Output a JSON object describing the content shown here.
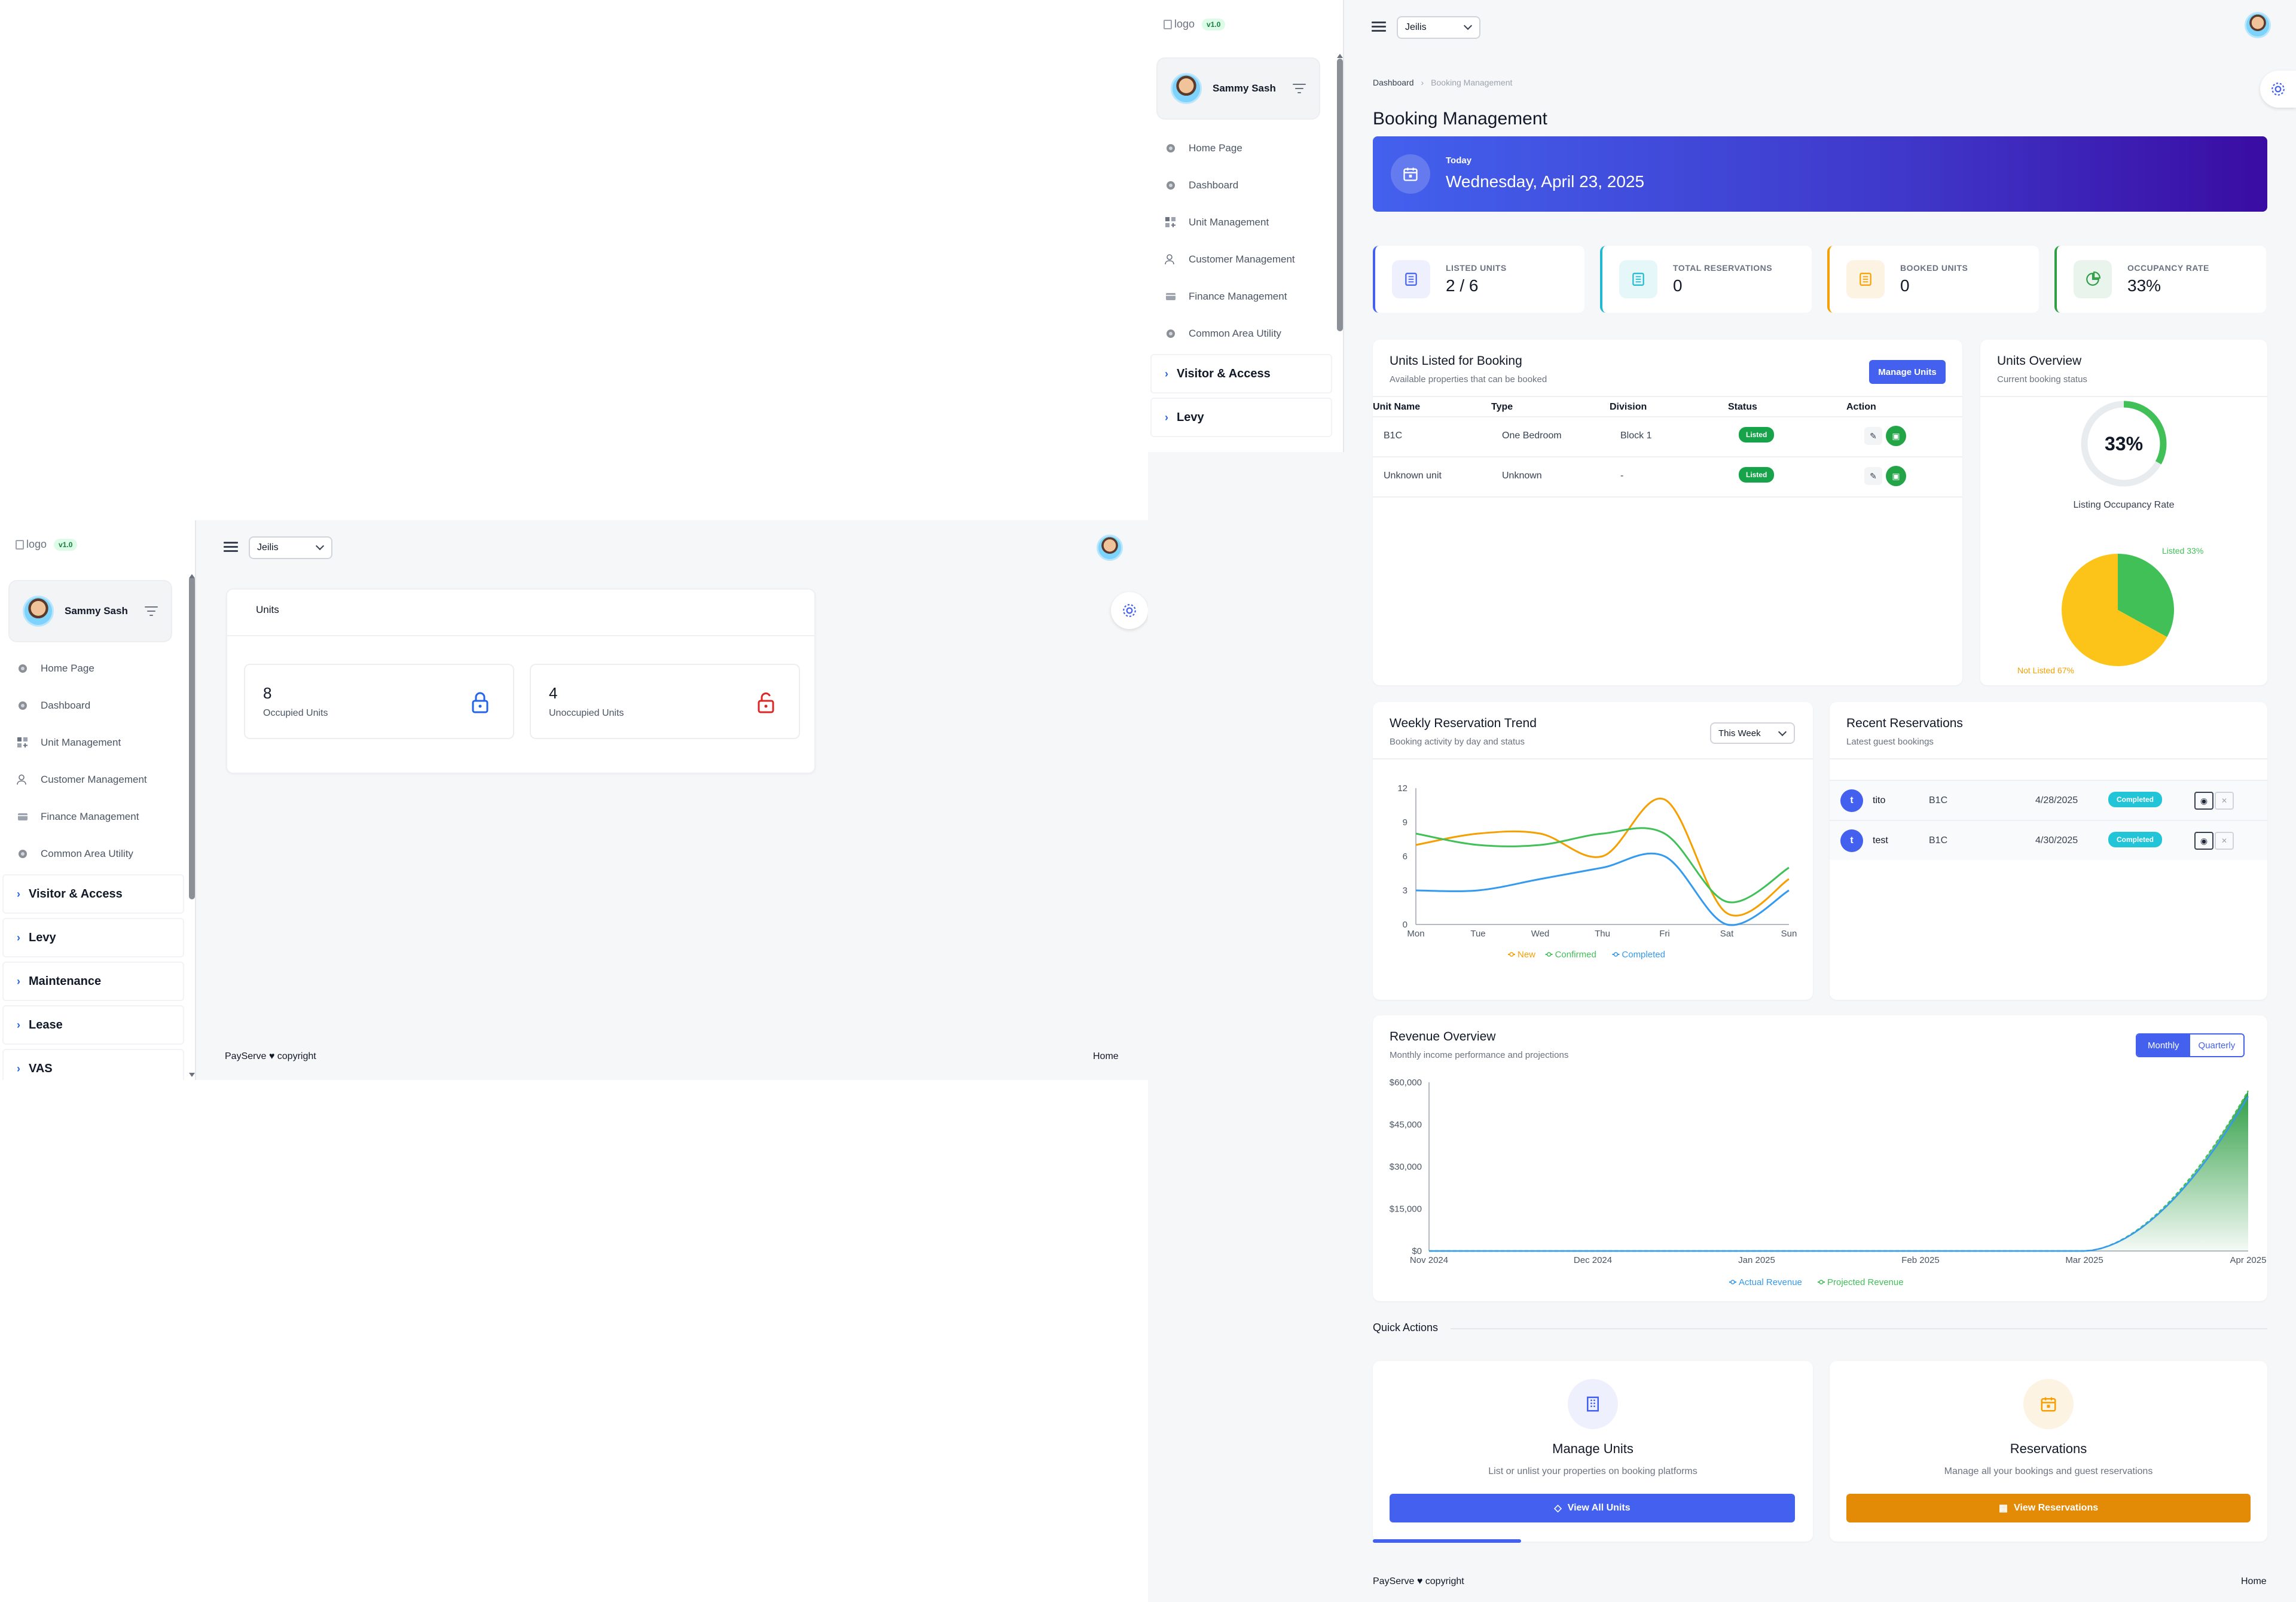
{
  "left_screen": {
    "logo_alt": "logo",
    "version": "v1.0",
    "user_name": "Sammy Sash",
    "nav": [
      "Home Page",
      "Dashboard",
      "Unit Management",
      "Customer Management",
      "Finance Management",
      "Common Area Utility"
    ],
    "groups": [
      "Visitor & Access",
      "Levy",
      "Maintenance",
      "Lease",
      "VAS"
    ],
    "property_select": "Jeilis",
    "units_card_title": "Units",
    "occupied": {
      "value": "8",
      "label": "Occupied Units"
    },
    "unoccupied": {
      "value": "4",
      "label": "Unoccupied Units"
    },
    "footer_brand": "PayServe",
    "footer_copy": "copyright",
    "footer_home": "Home"
  },
  "right_screen": {
    "logo_alt": "logo",
    "version": "v1.0",
    "user_name": "Sammy Sash",
    "nav": [
      "Home Page",
      "Dashboard",
      "Unit Management",
      "Customer Management",
      "Finance Management",
      "Common Area Utility"
    ],
    "groups": [
      "Visitor & Access",
      "Levy"
    ],
    "property_select": "Jeilis",
    "breadcrumb": {
      "home": "Dashboard",
      "current": "Booking Management"
    },
    "page_title": "Booking Management",
    "banner": {
      "label": "Today",
      "date": "Wednesday, April 23, 2025"
    },
    "stats": [
      {
        "label": "Listed Units",
        "value": "2 / 6",
        "color": "#4361ee"
      },
      {
        "label": "Total Reservations",
        "value": "0",
        "color": "#22b8cf"
      },
      {
        "label": "Booked Units",
        "value": "0",
        "color": "#f59f00"
      },
      {
        "label": "Occupancy Rate",
        "value": "33%",
        "color": "#2f9e44"
      }
    ],
    "units_table": {
      "title": "Units Listed for Booking",
      "subtitle": "Available properties that can be booked",
      "button": "Manage Units",
      "headers": [
        "Unit Name",
        "Type",
        "Division",
        "Status",
        "Action"
      ],
      "rows": [
        {
          "name": "B1C",
          "type": "One Bedroom",
          "division": "Block 1",
          "status": "Listed"
        },
        {
          "name": "Unknown unit",
          "type": "Unknown",
          "division": "-",
          "status": "Listed"
        }
      ]
    },
    "units_overview": {
      "title": "Units Overview",
      "subtitle": "Current booking status",
      "gauge_value": "33%",
      "gauge_fraction": 0.33,
      "gauge_caption": "Listing Occupancy Rate",
      "pie_listed_label": "Listed 33%",
      "pie_unlisted_label": "Not Listed 67%"
    },
    "weekly_trend": {
      "title": "Weekly Reservation Trend",
      "subtitle": "Booking activity by day and status",
      "range_select": "This Week"
    },
    "recent": {
      "title": "Recent Reservations",
      "subtitle": "Latest guest bookings",
      "rows": [
        {
          "initial": "t",
          "guest": "tito",
          "unit": "B1C",
          "date": "4/28/2025",
          "status": "Completed"
        },
        {
          "initial": "t",
          "guest": "test",
          "unit": "B1C",
          "date": "4/30/2025",
          "status": "Completed"
        }
      ]
    },
    "revenue": {
      "title": "Revenue Overview",
      "subtitle": "Monthly income performance and projections",
      "toggle_monthly": "Monthly",
      "toggle_quarterly": "Quarterly"
    },
    "quick_actions": {
      "heading": "Quick Actions",
      "units": {
        "title": "Manage Units",
        "desc": "List or unlist your properties on booking platforms",
        "button": "View All Units"
      },
      "reservations": {
        "title": "Reservations",
        "desc": "Manage all your bookings and guest reservations",
        "button": "View Reservations"
      }
    },
    "footer_brand": "PayServe",
    "footer_copy": "copyright",
    "footer_home": "Home"
  },
  "chart_data": [
    {
      "type": "line",
      "x": [
        "Mon",
        "Tue",
        "Wed",
        "Thu",
        "Fri",
        "Sat",
        "Sun"
      ],
      "ylim": [
        0,
        12
      ],
      "yticks": [
        0,
        3,
        6,
        9,
        12
      ],
      "series": [
        {
          "name": "New",
          "color": "#f59f00",
          "values": [
            7,
            8,
            8,
            6,
            11,
            1,
            4
          ]
        },
        {
          "name": "Confirmed",
          "color": "#40c057",
          "values": [
            8,
            7,
            7,
            8,
            8,
            2,
            5
          ]
        },
        {
          "name": "Completed",
          "color": "#339af0",
          "values": [
            3,
            3,
            4,
            5,
            6,
            0,
            3
          ]
        }
      ]
    },
    {
      "type": "area",
      "x": [
        "Nov 2024",
        "Dec 2024",
        "Jan 2025",
        "Feb 2025",
        "Mar 2025",
        "Apr 2025"
      ],
      "ylim": [
        0,
        60000
      ],
      "yticks": [
        "$0",
        "$15,000",
        "$30,000",
        "$45,000",
        "$60,000"
      ],
      "series": [
        {
          "name": "Actual Revenue",
          "color": "#339af0",
          "values": [
            0,
            0,
            0,
            0,
            0,
            55000
          ]
        },
        {
          "name": "Projected Revenue",
          "color": "#40c057",
          "values": [
            0,
            0,
            0,
            0,
            0,
            57000
          ]
        }
      ]
    },
    {
      "type": "pie",
      "categories": [
        "Listed",
        "Not Listed"
      ],
      "values": [
        33,
        67
      ],
      "colors": [
        "#40c057",
        "#fcc419"
      ]
    }
  ]
}
